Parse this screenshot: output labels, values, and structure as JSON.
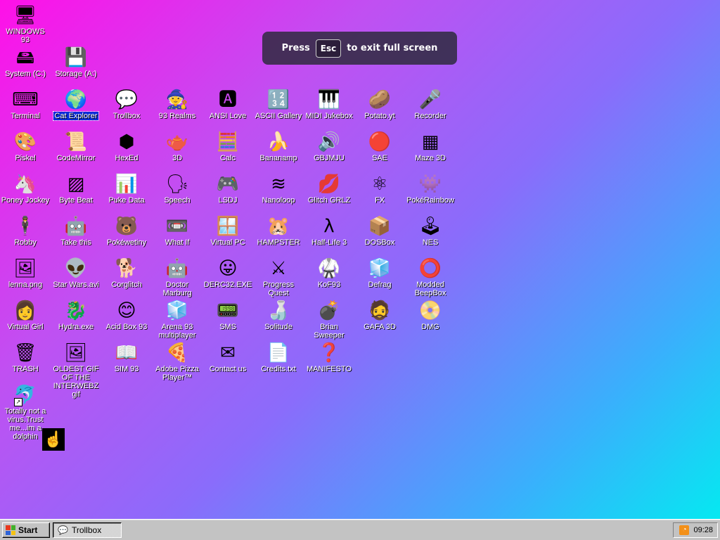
{
  "desktop": {
    "icons": [
      {
        "label": "WINDOWS 93",
        "glyph": "🖥"
      },
      {
        "label": "System (C:)",
        "glyph": "🖴"
      },
      {
        "label": "Storage (A:)",
        "glyph": "💾"
      },
      {
        "label": "Terminal",
        "glyph": "⌨"
      },
      {
        "label": "Cat Explorer",
        "glyph": "🌍"
      },
      {
        "label": "Trollbox",
        "glyph": "💬"
      },
      {
        "label": "93 Realms",
        "glyph": "🧙"
      },
      {
        "label": "ANSI Love",
        "glyph": "🅰"
      },
      {
        "label": "ASCII Gallery",
        "glyph": "🔢"
      },
      {
        "label": "MIDI Jukebox",
        "glyph": "🎹"
      },
      {
        "label": "Potato.yt",
        "glyph": "🥔"
      },
      {
        "label": "Recorder",
        "glyph": "🎤"
      },
      {
        "label": "Piskel",
        "glyph": "🎨"
      },
      {
        "label": "CodeMirror",
        "glyph": "📜"
      },
      {
        "label": "HexEd",
        "glyph": "⬢"
      },
      {
        "label": "3D",
        "glyph": "🫖"
      },
      {
        "label": "Calc",
        "glyph": "🧮"
      },
      {
        "label": "Bananamp",
        "glyph": "🍌"
      },
      {
        "label": "GBJMJU",
        "glyph": "🔊"
      },
      {
        "label": "SAE",
        "glyph": "🔴"
      },
      {
        "label": "Maze 3D",
        "glyph": "▦"
      },
      {
        "label": "Poney Jockey",
        "glyph": "🦄"
      },
      {
        "label": "Byte Beat",
        "glyph": "▨"
      },
      {
        "label": "Puke Data",
        "glyph": "📊"
      },
      {
        "label": "Speech",
        "glyph": "🗣"
      },
      {
        "label": "LSDJ",
        "glyph": "🎮"
      },
      {
        "label": "Nanoloop",
        "glyph": "≋"
      },
      {
        "label": "Glitch GRLZ",
        "glyph": "💋"
      },
      {
        "label": "FX",
        "glyph": "⚛"
      },
      {
        "label": "PokéRainbow",
        "glyph": "👾"
      },
      {
        "label": "Robby",
        "glyph": "🕴"
      },
      {
        "label": "Take this",
        "glyph": "🤖"
      },
      {
        "label": "Pokéwetiny",
        "glyph": "🐻"
      },
      {
        "label": "What If",
        "glyph": "📼"
      },
      {
        "label": "Virtual PC",
        "glyph": "🪟"
      },
      {
        "label": "HAMPSTER",
        "glyph": "🐹"
      },
      {
        "label": "Half-Life 3",
        "glyph": "λ"
      },
      {
        "label": "DOSBox",
        "glyph": "📦"
      },
      {
        "label": "NES",
        "glyph": "🕹"
      },
      {
        "label": "lenna.png",
        "glyph": "🖼"
      },
      {
        "label": "Star Wars.avi",
        "glyph": "👽"
      },
      {
        "label": "Corglitch",
        "glyph": "🐕"
      },
      {
        "label": "Doctor Marburg",
        "glyph": "🤖"
      },
      {
        "label": "DERC32.EXE",
        "glyph": "😛"
      },
      {
        "label": "Progress Quest",
        "glyph": "⚔"
      },
      {
        "label": "KoF93",
        "glyph": "🥋"
      },
      {
        "label": "Defrag",
        "glyph": "🧊"
      },
      {
        "label": "Modded BeepBox",
        "glyph": "⭕"
      },
      {
        "label": "Virtual Girl",
        "glyph": "👩"
      },
      {
        "label": "Hydra.exe",
        "glyph": "🐉"
      },
      {
        "label": "Acid Box 93",
        "glyph": "😊"
      },
      {
        "label": "Arena 93 multiplayer",
        "glyph": "🧊"
      },
      {
        "label": "SMS",
        "glyph": "📟"
      },
      {
        "label": "Solitude",
        "glyph": "🍶"
      },
      {
        "label": "Brian Sweeper",
        "glyph": "💣"
      },
      {
        "label": "GAFA 3D",
        "glyph": "🧔"
      },
      {
        "label": "DMG",
        "glyph": "📀"
      },
      {
        "label": "TRASH",
        "glyph": "🗑"
      },
      {
        "label": "OLDEST GIF OF THE INTERWEBZ gif",
        "glyph": "🖼"
      },
      {
        "label": "SIM 93",
        "glyph": "📖"
      },
      {
        "label": "Adobe Pizza Player™",
        "glyph": "🍕"
      },
      {
        "label": "Contact us",
        "glyph": "✉"
      },
      {
        "label": "Credits.txt",
        "glyph": "📄"
      },
      {
        "label": "MANIFESTO",
        "glyph": "❓"
      },
      {
        "label": "Totally not a virus.Trust me...im a dolphin",
        "glyph": "🐬"
      }
    ],
    "selected_label": "Cat Explorer"
  },
  "fullscreen_banner": {
    "before": "Press",
    "key": "Esc",
    "after": "to exit full screen"
  },
  "taskbar": {
    "start_label": "Start",
    "tasks": [
      {
        "label": "Trollbox"
      }
    ],
    "clock": "09:28"
  },
  "colors": {
    "gradient_start": "#ff10e8",
    "gradient_end": "#00eef0",
    "selection": "#0a2bd8",
    "taskbar": "#c3c3c3"
  }
}
